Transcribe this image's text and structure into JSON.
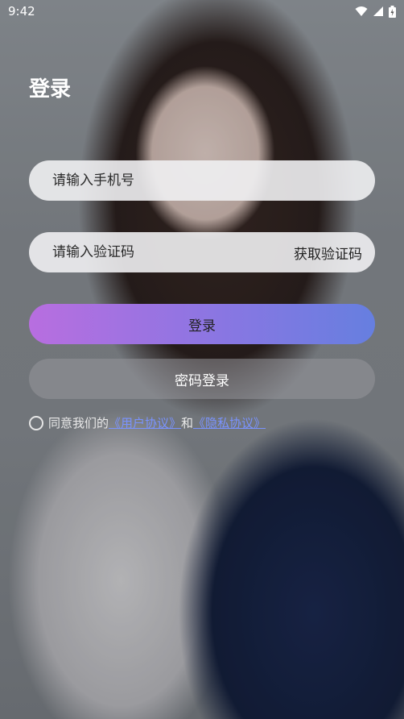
{
  "status_bar": {
    "time": "9:42"
  },
  "title": "登录",
  "phone_input": {
    "placeholder": "请输入手机号",
    "value": ""
  },
  "code_input": {
    "placeholder": "请输入验证码",
    "value": ""
  },
  "get_code_label": "获取验证码",
  "login_button": "登录",
  "password_login_button": "密码登录",
  "agreement": {
    "prefix": "同意我们的",
    "user_agreement": "《用户协议》",
    "and": "和",
    "privacy_policy": "《隐私协议》"
  },
  "colors": {
    "login_gradient_start": "#b86ee0",
    "login_gradient_end": "#667fe0",
    "link": "#7a93ff"
  }
}
